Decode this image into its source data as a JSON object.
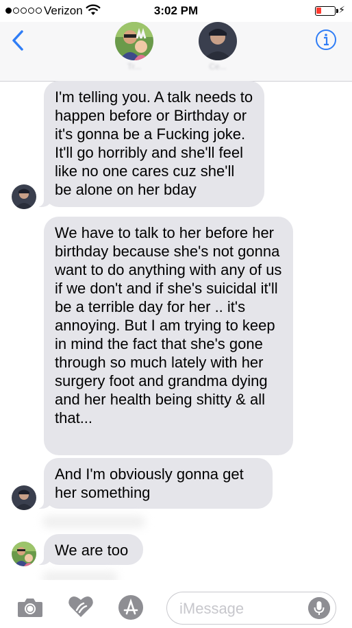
{
  "status_bar": {
    "carrier": "Verizon",
    "time": "3:02 PM",
    "signal_bars": 1,
    "signal_total": 5,
    "battery_level_fraction": 0.15,
    "battery_color": "#ff3b30"
  },
  "header": {
    "back_icon": "chevron-left-icon",
    "info_icon": "info-circle-icon",
    "contacts": [
      {
        "name": "Tr..."
      },
      {
        "name": "Ce..."
      }
    ],
    "accent_color": "#2f7df6"
  },
  "messages": [
    {
      "sender": "contact-2",
      "text": "I'm telling you. A talk needs to happen before or Birthday or it's gonna be a Fucking joke. It'll go horribly and she'll feel like no one cares cuz she'll be alone on her bday"
    },
    {
      "sender": "contact-2",
      "text": "We have to talk to her before her birthday because she's not gonna want to do anything with any of us if we don't and if she's suicidal it'll be a terrible day for her .. it's annoying. But I am trying to keep in mind the fact that she's gone through so much lately with her surgery foot and grandma dying and her health being shitty & all that..."
    },
    {
      "sender": "contact-2",
      "text": "And I'm obviously gonna get her something"
    },
    {
      "sender": "contact-1",
      "text": "We are too"
    }
  ],
  "composer": {
    "placeholder": "iMessage",
    "icons": [
      "camera-icon",
      "digital-touch-icon",
      "app-store-icon",
      "microphone-icon"
    ]
  },
  "colors": {
    "incoming_bubble": "#e5e5ea",
    "icon_gray": "#8e8e93"
  }
}
